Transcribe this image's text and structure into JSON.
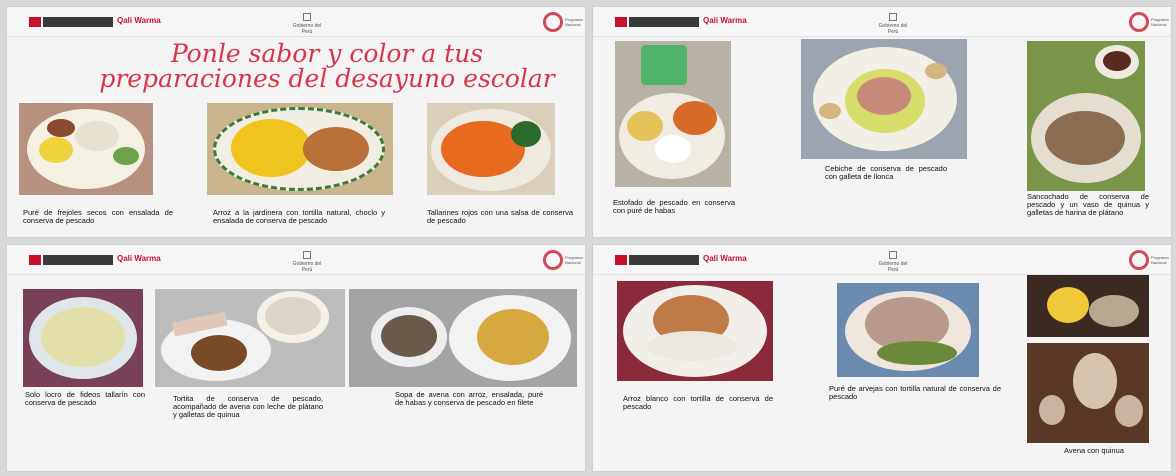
{
  "slides": [
    {
      "header": {
        "brand": "Qali Warma",
        "mid": "Gobierno del Perú",
        "logo": "Programa Nacional"
      },
      "title": "Ponle sabor y color a tus preparaciones del desayuno escolar",
      "captions": [
        "Puré de frejoles secos con ensalada de conserva de pescado",
        "Arroz a la jardinera con tortilla natural, choclo y ensalada de conserva de pescado",
        "Tallarines rojos con una salsa de conserva de pescado"
      ]
    },
    {
      "header": {
        "brand": "Qali Warma",
        "mid": "Gobierno del Perú",
        "logo": "Programa Nacional"
      },
      "captions": [
        "Estofado de pescado en conserva con puré de habas",
        "Cebiche de conserva de pescado con galleta de llonca",
        "Sancochado de conserva de pescado y un vaso de quinua y galletas de harina de plátano"
      ]
    },
    {
      "header": {
        "brand": "Qali Warma",
        "mid": "Gobierno del Perú",
        "logo": "Programa Nacional"
      },
      "captions": [
        "Solo locro de fideos tallarín con conserva de pescado",
        "Tortita de conserva de pescado, acompañado de avena con leche de plátano y galletas de quinua",
        "Sopa de avena con arroz, ensalada, puré de habas y conserva de pescado en filete"
      ]
    },
    {
      "header": {
        "brand": "Qali Warma",
        "mid": "Gobierno del Perú",
        "logo": "Programa Nacional"
      },
      "captions": [
        "Arroz blanco con tortilla de conserva de pescado",
        "Puré de arvejas con tortilla natural de conserva de pescado",
        "Avena con quinua"
      ]
    }
  ],
  "colors": {
    "accent": "#d8354a",
    "brand_red": "#c8102e"
  }
}
